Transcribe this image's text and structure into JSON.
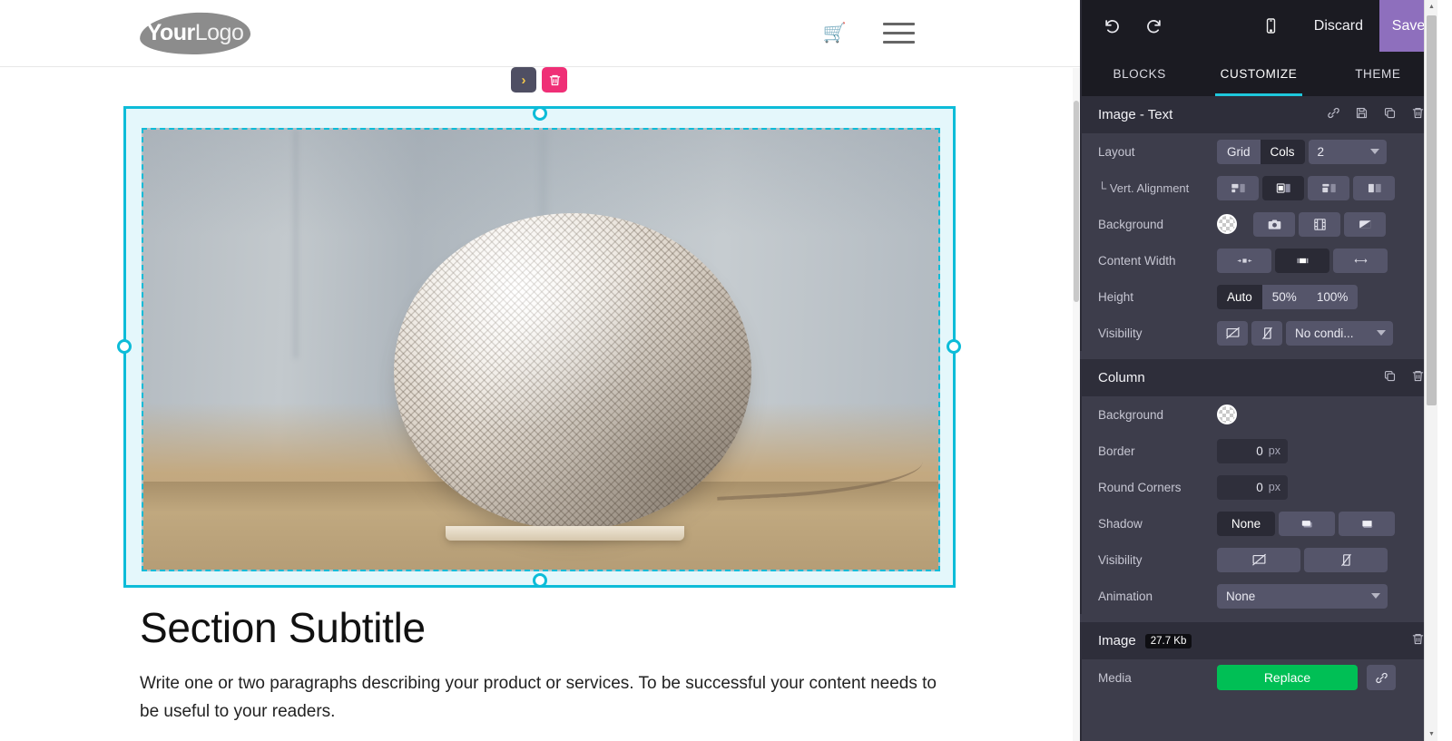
{
  "site": {
    "logo": {
      "bold": "Your",
      "light": "Logo"
    },
    "cart_icon": "shopping-cart-icon",
    "menu_icon": "hamburger-menu-icon",
    "section_title": "Section Subtitle",
    "section_paragraph": "Write one or two paragraphs describing your product or services. To be successful your content needs to be useful to your readers."
  },
  "block_toolbar": {
    "expand_label": "›",
    "delete_icon": "trash-icon"
  },
  "editor": {
    "top_bar": {
      "undo_icon": "undo-icon",
      "redo_icon": "redo-icon",
      "mobile_icon": "mobile-preview-icon",
      "discard_label": "Discard",
      "save_label": "Save",
      "save_color": "#8e6fbd"
    },
    "tabs": [
      {
        "label": "BLOCKS",
        "active": false
      },
      {
        "label": "CUSTOMIZE",
        "active": true
      },
      {
        "label": "THEME",
        "active": false
      }
    ],
    "accent_color": "#1ec8dc",
    "sections": [
      {
        "title": "Image - Text",
        "badge": null,
        "tools": [
          "link-icon",
          "save-disk-icon",
          "duplicate-icon",
          "trash-icon"
        ],
        "rows": [
          {
            "label": "Layout",
            "segments": [
              {
                "label": "Grid",
                "active": false
              },
              {
                "label": "Cols",
                "active": true
              }
            ],
            "select": {
              "value": "2"
            }
          },
          {
            "label": "└ Vert. Alignment",
            "icons": [
              {
                "name": "align-top-icon",
                "active": false
              },
              {
                "name": "align-middle-icon",
                "active": true
              },
              {
                "name": "align-bottom-icon",
                "active": false
              },
              {
                "name": "align-stretch-icon",
                "active": false
              }
            ]
          },
          {
            "label": "Background",
            "swatch": "transparent-checker",
            "icons": [
              {
                "name": "camera-icon",
                "active": false
              },
              {
                "name": "video-icon",
                "active": false
              },
              {
                "name": "gradient-icon",
                "active": false
              }
            ]
          },
          {
            "label": "Content Width",
            "icons": [
              {
                "name": "width-narrow-icon",
                "active": false
              },
              {
                "name": "width-boxed-icon",
                "active": true
              },
              {
                "name": "width-full-icon",
                "active": false
              }
            ]
          },
          {
            "label": "Height",
            "segments": [
              {
                "label": "Auto",
                "active": true
              },
              {
                "label": "50%",
                "active": false
              },
              {
                "label": "100%",
                "active": false
              }
            ]
          },
          {
            "label": "Visibility",
            "icons": [
              {
                "name": "hide-desktop-icon",
                "active": false
              },
              {
                "name": "hide-mobile-icon",
                "active": false
              }
            ],
            "select": {
              "value": "No condi..."
            }
          }
        ]
      },
      {
        "title": "Column",
        "badge": null,
        "tools": [
          "duplicate-icon",
          "trash-icon"
        ],
        "rows": [
          {
            "label": "Background",
            "swatch": "transparent-checker"
          },
          {
            "label": "Border",
            "number": {
              "value": "0",
              "unit": "px"
            }
          },
          {
            "label": "Round Corners",
            "number": {
              "value": "0",
              "unit": "px"
            }
          },
          {
            "label": "Shadow",
            "segments": [
              {
                "label": "None",
                "active": true
              }
            ],
            "icons": [
              {
                "name": "shadow-soft-icon",
                "active": false
              },
              {
                "name": "shadow-lifted-icon",
                "active": false
              }
            ]
          },
          {
            "label": "Visibility",
            "icons": [
              {
                "name": "hide-desktop-icon",
                "active": false
              },
              {
                "name": "hide-mobile-icon",
                "active": false
              }
            ]
          },
          {
            "label": "Animation",
            "select": {
              "value": "None"
            }
          }
        ]
      },
      {
        "title": "Image",
        "badge": "27.7 Kb",
        "tools": [
          "trash-icon"
        ],
        "rows": [
          {
            "label": "Media",
            "button": {
              "label": "Replace",
              "color": "#00bf55"
            },
            "icons": [
              {
                "name": "link-icon",
                "active": false
              }
            ]
          }
        ]
      }
    ]
  }
}
